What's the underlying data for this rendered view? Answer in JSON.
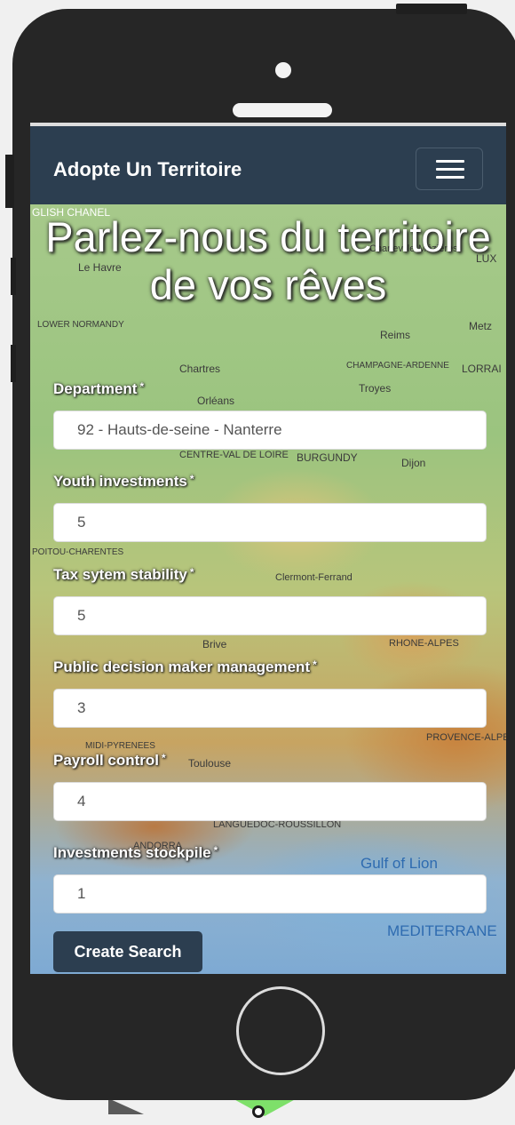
{
  "navbar": {
    "brand": "Adopte Un Territoire",
    "menu_icon": "hamburger-menu-icon"
  },
  "hero": {
    "title": "Parlez-nous du territoire de vos rêves"
  },
  "form": {
    "fields": [
      {
        "label": "Department",
        "required_mark": "*",
        "value": "92 - Hauts-de-seine - Nanterre"
      },
      {
        "label": "Youth investments",
        "required_mark": "*",
        "value": "5"
      },
      {
        "label": "Tax sytem stability",
        "required_mark": "*",
        "value": "5"
      },
      {
        "label": "Public decision maker management",
        "required_mark": "*",
        "value": "3"
      },
      {
        "label": "Payroll control",
        "required_mark": "*",
        "value": "4"
      },
      {
        "label": "Investments stockpile",
        "required_mark": "*",
        "value": "1"
      }
    ],
    "submit_label": "Create Search"
  },
  "map": {
    "labels": [
      "GLISH CHANEL",
      "Le Havre",
      "LOWER NORMANDY",
      "Chartres",
      "Orléans",
      "CENTRE-VAL DE LOIRE",
      "BURGUNDY",
      "Dijon",
      "POITOU-CHARENTES",
      "Clermont-Ferrand",
      "Brive",
      "RHONE-ALPES",
      "MIDI-PYRENEES",
      "Toulouse",
      "LANGUEDOC-ROUSSILLON",
      "ANDORRA",
      "PROVENCE-ALPE",
      "Charleville-Mézières",
      "CHAMPAGNE-ARDENNE",
      "LORRAI",
      "Reims",
      "Troyes",
      "Metz",
      "LUX"
    ],
    "seas": [
      "Gulf of Lion",
      "MEDITERRANE"
    ]
  },
  "colors": {
    "navbar": "#2c3e50",
    "button": "#2c3e50",
    "phone_body": "#262626"
  }
}
